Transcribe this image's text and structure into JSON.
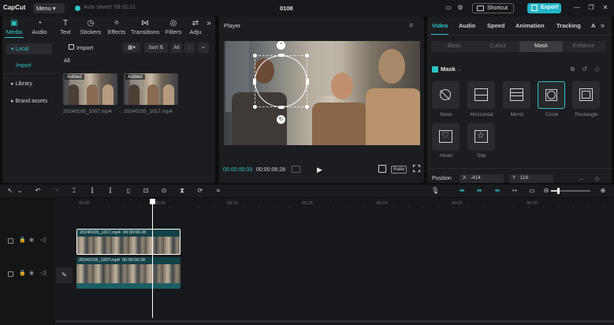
{
  "titlebar": {
    "logo": "CapCut",
    "menu_label": "Menu",
    "autosave": "Auto saved: 09:32:21",
    "doc_title": "0108",
    "shortcut_label": "Shortcut",
    "export_label": "Export"
  },
  "media": {
    "tabs": [
      {
        "label": "Media",
        "icon": "media-icon",
        "active": true
      },
      {
        "label": "Audio",
        "icon": "audio-icon"
      },
      {
        "label": "Text",
        "icon": "text-icon"
      },
      {
        "label": "Stickers",
        "icon": "stickers-icon"
      },
      {
        "label": "Effects",
        "icon": "effects-icon"
      },
      {
        "label": "Transitions",
        "icon": "transitions-icon"
      },
      {
        "label": "Filters",
        "icon": "filters-icon"
      },
      {
        "label": "Adju",
        "icon": "adjust-icon"
      }
    ],
    "sidebar": {
      "local": "Local",
      "import_sub": "Import",
      "library": "Library",
      "brand_assets": "Brand assets"
    },
    "import_label": "Import",
    "sort_label": "Sort",
    "all_btn": "All",
    "all_label": "All",
    "items": [
      {
        "badge": "Added",
        "name": "20240105_1007.mp4"
      },
      {
        "badge": "Added",
        "name": "20240105_1017.mp4"
      }
    ]
  },
  "player": {
    "label": "Player",
    "current_time": "00:00:05:03",
    "total_time": "00:00:06:28",
    "ratio_label": "Ratio"
  },
  "props": {
    "tabs": [
      "Video",
      "Audio",
      "Speed",
      "Animation",
      "Tracking",
      "A"
    ],
    "active_tab": "Video",
    "segments": [
      "Basic",
      "Cutout",
      "Mask",
      "Enhance"
    ],
    "active_segment": "Mask",
    "mask_title": "Mask",
    "shapes": [
      {
        "label": "None",
        "icon": "none-icon"
      },
      {
        "label": "Horizontal",
        "icon": "horizontal-icon"
      },
      {
        "label": "Mirror",
        "icon": "mirror-icon"
      },
      {
        "label": "Circle",
        "icon": "circle-icon",
        "selected": true
      },
      {
        "label": "Rectangle",
        "icon": "rectangle-icon"
      },
      {
        "label": "Heart",
        "icon": "heart-icon"
      },
      {
        "label": "Star",
        "icon": "star-icon"
      }
    ],
    "position_label": "Position",
    "x_label": "X",
    "x_value": "-414",
    "y_label": "Y",
    "y_value": "116"
  },
  "timeline": {
    "ticks": [
      "00:00",
      "00:05",
      "00:10",
      "00:15",
      "00:20",
      "00:25",
      "00:30"
    ],
    "clips": [
      {
        "name": "20240105_1017.mp4",
        "duration": "00:00:06:28"
      },
      {
        "name": "20240105_1007.mp4",
        "duration": "00:00:06:28"
      }
    ],
    "zoom_level": 0.18
  },
  "colors": {
    "accent": "#2ec4c9",
    "export_bg": "#22b4c6",
    "panel_bg": "#1c1d20",
    "app_bg": "#0d0d0f"
  }
}
